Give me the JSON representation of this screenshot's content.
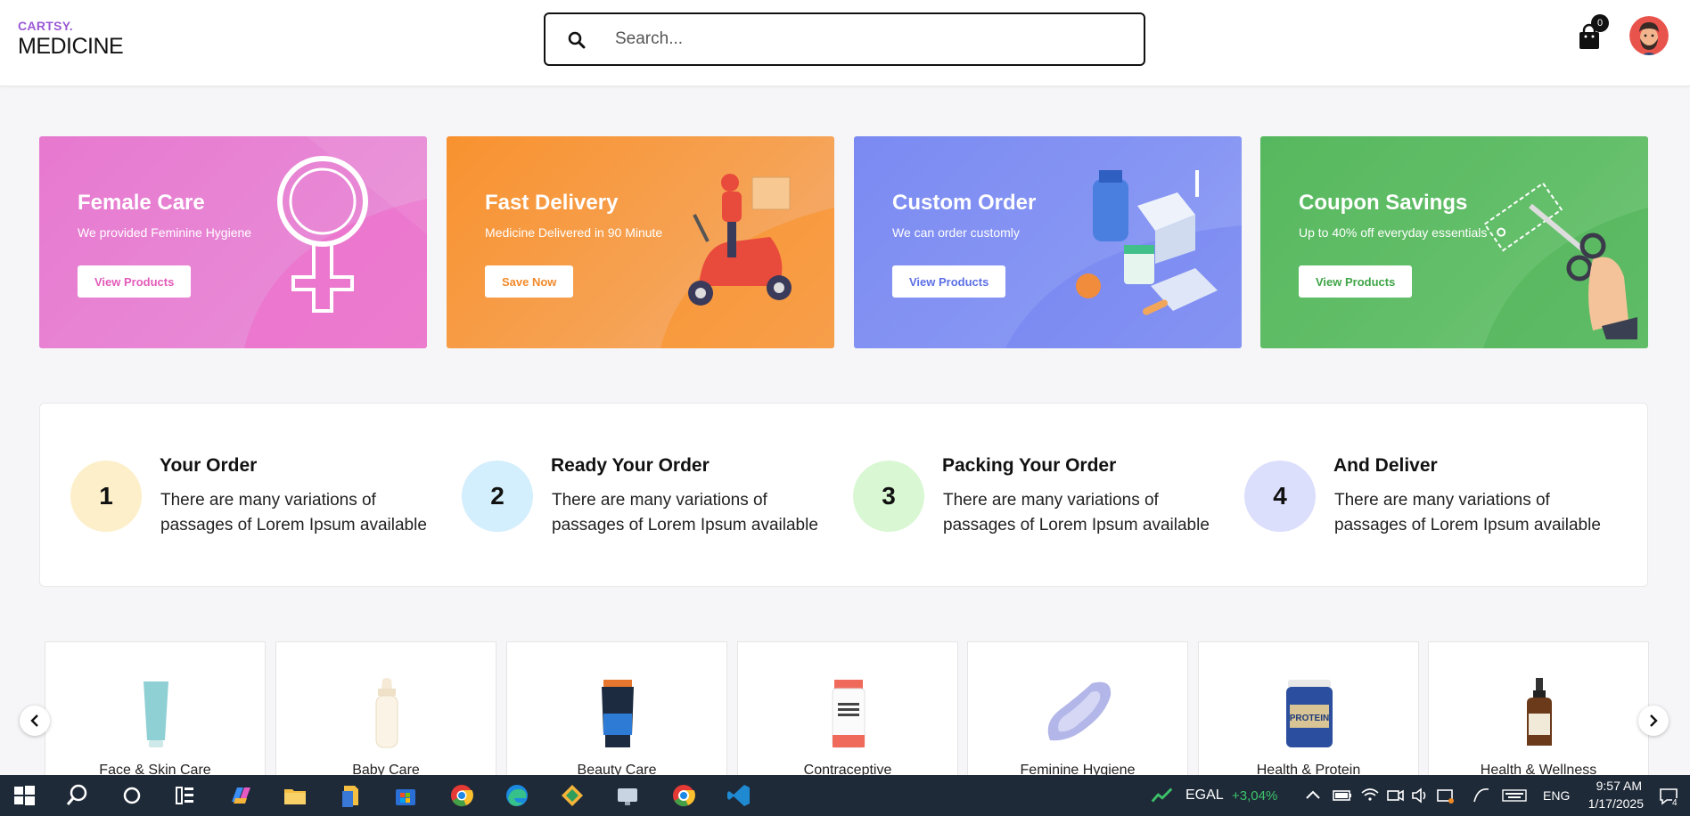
{
  "header": {
    "brand": "CARTSY.",
    "logo_name": "MEDICINE",
    "search_placeholder": "Search...",
    "cart_count": "0"
  },
  "banners": [
    {
      "title": "Female Care",
      "subtitle": "We provided Feminine Hygiene",
      "button": "View Products",
      "color": "#e779cf",
      "button_color": "#e35bb9"
    },
    {
      "title": "Fast Delivery",
      "subtitle": "Medicine Delivered in 90 Minute",
      "button": "Save Now",
      "color": "#f8922f",
      "button_color": "#f28a2a"
    },
    {
      "title": "Custom Order",
      "subtitle": "We can order customly",
      "button": "View Products",
      "color": "#7b8af2",
      "button_color": "#5c6fe6"
    },
    {
      "title": "Coupon Savings",
      "subtitle": "Up to 40% off everyday essentials",
      "button": "View Products",
      "color": "#56b85e",
      "button_color": "#3fa547"
    }
  ],
  "steps": [
    {
      "number": "1",
      "title": "Your Order",
      "description": "There are many variations of passages of Lorem Ipsum available",
      "color": "#fcefc9"
    },
    {
      "number": "2",
      "title": "Ready Your Order",
      "description": "There are many variations of passages of Lorem Ipsum available",
      "color": "#d3eefc"
    },
    {
      "number": "3",
      "title": "Packing Your Order",
      "description": "There are many variations of passages of Lorem Ipsum available",
      "color": "#d9f7d3"
    },
    {
      "number": "4",
      "title": "And Deliver",
      "description": "There are many variations of passages of Lorem Ipsum available",
      "color": "#dcdffc"
    }
  ],
  "categories": [
    {
      "label": "Face & Skin Care",
      "icon": "lotion-tube-icon"
    },
    {
      "label": "Baby Care",
      "icon": "baby-bottle-icon"
    },
    {
      "label": "Beauty Care",
      "icon": "face-wash-tube-icon"
    },
    {
      "label": "Contraceptive",
      "icon": "supplement-jar-icon"
    },
    {
      "label": "Feminine Hygiene",
      "icon": "sanitary-pad-icon"
    },
    {
      "label": "Health & Protein",
      "icon": "protein-tub-icon"
    },
    {
      "label": "Health & Wellness",
      "icon": "dropper-bottle-icon"
    }
  ],
  "taskbar": {
    "stock_name": "EGAL",
    "stock_change": "+3,04%",
    "language": "ENG",
    "time": "9:57 AM",
    "date": "1/17/2025",
    "notification_count": "4"
  }
}
